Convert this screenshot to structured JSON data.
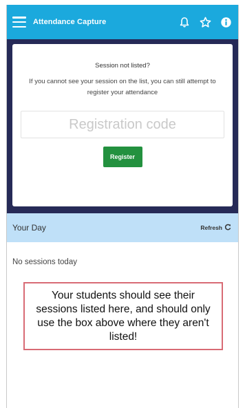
{
  "header": {
    "title": "Attendance Capture",
    "icons": [
      "menu-icon",
      "bell-icon",
      "star-icon",
      "info-icon"
    ]
  },
  "register_card": {
    "heading": "Session not listed?",
    "text": "If you cannot see your session on the list, you can still attempt to register your attendance",
    "input_placeholder": "Registration code",
    "input_value": "",
    "button_label": "Register"
  },
  "your_day": {
    "title": "Your Day",
    "refresh_label": "Refresh"
  },
  "content": {
    "empty_text": "No sessions today",
    "note_text": "Your students should see their sessions listed here, and should only use the box above where they aren't listed!"
  },
  "colors": {
    "appbar": "#1ba9dd",
    "dark_panel": "#262a57",
    "register_button": "#23913f",
    "day_bar": "#bfe0f8",
    "note_border": "#d86a74"
  }
}
